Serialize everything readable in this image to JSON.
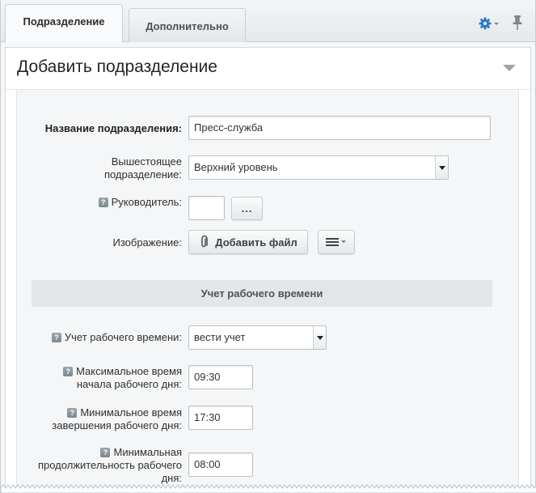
{
  "tabs": [
    {
      "label": "Подразделение",
      "active": true
    },
    {
      "label": "Дополнительно",
      "active": false
    }
  ],
  "toolbar": {
    "settings_icon": "gear-icon",
    "pin_icon": "pin-icon"
  },
  "header": {
    "title": "Добавить подразделение",
    "collapse_icon": "triangle-down-icon"
  },
  "form": {
    "name_label": "Название подразделения:",
    "name_value": "Пресс-служба",
    "parent_label_1": "Вышестоящее",
    "parent_label_2": "подразделение:",
    "parent_value": "Верхний уровень",
    "manager_label": "Руководитель:",
    "manager_value": "",
    "manager_button": "...",
    "image_label": "Изображение:",
    "add_file_button": "Добавить файл",
    "help_glyph": "?"
  },
  "worktime": {
    "section_title": "Учет рабочего времени",
    "tracking_label": "Учет рабочего времени:",
    "tracking_value": "вести учет",
    "max_start_label_1": "Максимальное время",
    "max_start_label_2": "начала рабочего дня:",
    "max_start_value": "09:30",
    "min_end_label_1": "Минимальное время",
    "min_end_label_2": "завершения рабочего дня:",
    "min_end_value": "17:30",
    "min_duration_label_1": "Минимальная",
    "min_duration_label_2": "продолжительность рабочего",
    "min_duration_label_3": "дня:",
    "min_duration_value": "08:00"
  },
  "colors": {
    "accent": "#2a7ac6",
    "frame": "#c6cdd2",
    "section_bg": "#e3e6e8"
  }
}
